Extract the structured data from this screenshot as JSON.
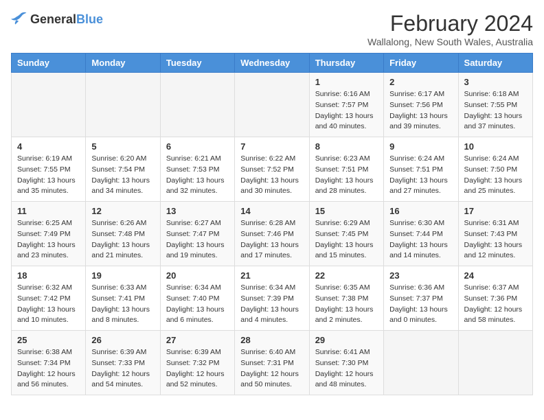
{
  "header": {
    "logo_general": "General",
    "logo_blue": "Blue",
    "title": "February 2024",
    "subtitle": "Wallalong, New South Wales, Australia"
  },
  "columns": [
    "Sunday",
    "Monday",
    "Tuesday",
    "Wednesday",
    "Thursday",
    "Friday",
    "Saturday"
  ],
  "weeks": [
    [
      {
        "day": "",
        "info": ""
      },
      {
        "day": "",
        "info": ""
      },
      {
        "day": "",
        "info": ""
      },
      {
        "day": "",
        "info": ""
      },
      {
        "day": "1",
        "info": "Sunrise: 6:16 AM\nSunset: 7:57 PM\nDaylight: 13 hours and 40 minutes."
      },
      {
        "day": "2",
        "info": "Sunrise: 6:17 AM\nSunset: 7:56 PM\nDaylight: 13 hours and 39 minutes."
      },
      {
        "day": "3",
        "info": "Sunrise: 6:18 AM\nSunset: 7:55 PM\nDaylight: 13 hours and 37 minutes."
      }
    ],
    [
      {
        "day": "4",
        "info": "Sunrise: 6:19 AM\nSunset: 7:55 PM\nDaylight: 13 hours and 35 minutes."
      },
      {
        "day": "5",
        "info": "Sunrise: 6:20 AM\nSunset: 7:54 PM\nDaylight: 13 hours and 34 minutes."
      },
      {
        "day": "6",
        "info": "Sunrise: 6:21 AM\nSunset: 7:53 PM\nDaylight: 13 hours and 32 minutes."
      },
      {
        "day": "7",
        "info": "Sunrise: 6:22 AM\nSunset: 7:52 PM\nDaylight: 13 hours and 30 minutes."
      },
      {
        "day": "8",
        "info": "Sunrise: 6:23 AM\nSunset: 7:51 PM\nDaylight: 13 hours and 28 minutes."
      },
      {
        "day": "9",
        "info": "Sunrise: 6:24 AM\nSunset: 7:51 PM\nDaylight: 13 hours and 27 minutes."
      },
      {
        "day": "10",
        "info": "Sunrise: 6:24 AM\nSunset: 7:50 PM\nDaylight: 13 hours and 25 minutes."
      }
    ],
    [
      {
        "day": "11",
        "info": "Sunrise: 6:25 AM\nSunset: 7:49 PM\nDaylight: 13 hours and 23 minutes."
      },
      {
        "day": "12",
        "info": "Sunrise: 6:26 AM\nSunset: 7:48 PM\nDaylight: 13 hours and 21 minutes."
      },
      {
        "day": "13",
        "info": "Sunrise: 6:27 AM\nSunset: 7:47 PM\nDaylight: 13 hours and 19 minutes."
      },
      {
        "day": "14",
        "info": "Sunrise: 6:28 AM\nSunset: 7:46 PM\nDaylight: 13 hours and 17 minutes."
      },
      {
        "day": "15",
        "info": "Sunrise: 6:29 AM\nSunset: 7:45 PM\nDaylight: 13 hours and 15 minutes."
      },
      {
        "day": "16",
        "info": "Sunrise: 6:30 AM\nSunset: 7:44 PM\nDaylight: 13 hours and 14 minutes."
      },
      {
        "day": "17",
        "info": "Sunrise: 6:31 AM\nSunset: 7:43 PM\nDaylight: 13 hours and 12 minutes."
      }
    ],
    [
      {
        "day": "18",
        "info": "Sunrise: 6:32 AM\nSunset: 7:42 PM\nDaylight: 13 hours and 10 minutes."
      },
      {
        "day": "19",
        "info": "Sunrise: 6:33 AM\nSunset: 7:41 PM\nDaylight: 13 hours and 8 minutes."
      },
      {
        "day": "20",
        "info": "Sunrise: 6:34 AM\nSunset: 7:40 PM\nDaylight: 13 hours and 6 minutes."
      },
      {
        "day": "21",
        "info": "Sunrise: 6:34 AM\nSunset: 7:39 PM\nDaylight: 13 hours and 4 minutes."
      },
      {
        "day": "22",
        "info": "Sunrise: 6:35 AM\nSunset: 7:38 PM\nDaylight: 13 hours and 2 minutes."
      },
      {
        "day": "23",
        "info": "Sunrise: 6:36 AM\nSunset: 7:37 PM\nDaylight: 13 hours and 0 minutes."
      },
      {
        "day": "24",
        "info": "Sunrise: 6:37 AM\nSunset: 7:36 PM\nDaylight: 12 hours and 58 minutes."
      }
    ],
    [
      {
        "day": "25",
        "info": "Sunrise: 6:38 AM\nSunset: 7:34 PM\nDaylight: 12 hours and 56 minutes."
      },
      {
        "day": "26",
        "info": "Sunrise: 6:39 AM\nSunset: 7:33 PM\nDaylight: 12 hours and 54 minutes."
      },
      {
        "day": "27",
        "info": "Sunrise: 6:39 AM\nSunset: 7:32 PM\nDaylight: 12 hours and 52 minutes."
      },
      {
        "day": "28",
        "info": "Sunrise: 6:40 AM\nSunset: 7:31 PM\nDaylight: 12 hours and 50 minutes."
      },
      {
        "day": "29",
        "info": "Sunrise: 6:41 AM\nSunset: 7:30 PM\nDaylight: 12 hours and 48 minutes."
      },
      {
        "day": "",
        "info": ""
      },
      {
        "day": "",
        "info": ""
      }
    ]
  ]
}
